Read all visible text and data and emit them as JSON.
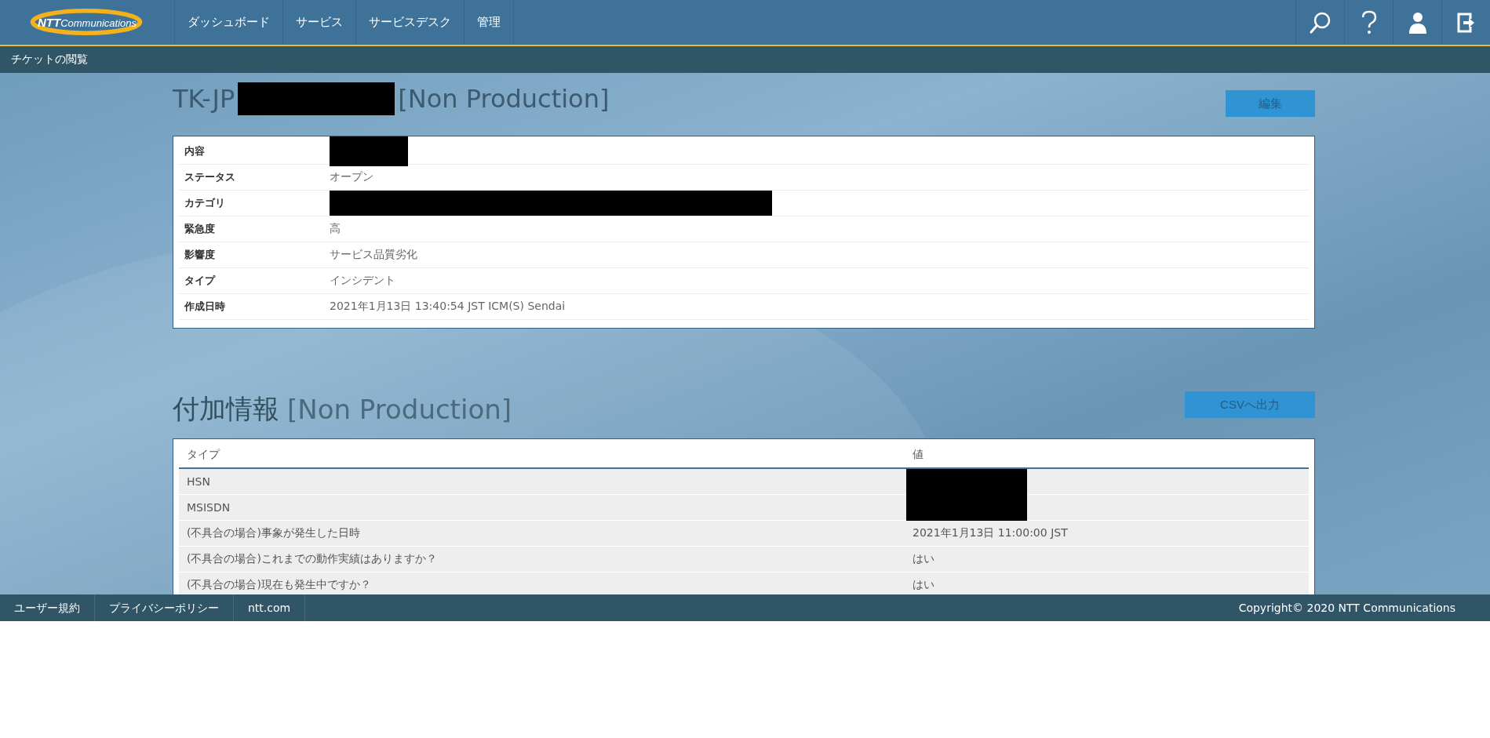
{
  "header": {
    "logo": {
      "bold": "NTT",
      "rest": "Communications"
    },
    "nav": [
      {
        "label": "ダッシュボード"
      },
      {
        "label": "サービス"
      },
      {
        "label": "サービスデスク"
      },
      {
        "label": "管理"
      }
    ]
  },
  "breadcrumb": "チケットの閲覧",
  "ticket": {
    "title_prefix": "TK-JP",
    "title_redacted": true,
    "title_suffix": "[Non Production]",
    "edit_button": "編集",
    "fields": [
      {
        "label": "内容",
        "kind": "redacted-short"
      },
      {
        "label": "ステータス",
        "kind": "text",
        "value": "オープン"
      },
      {
        "label": "カテゴリ",
        "kind": "redacted-long"
      },
      {
        "label": "緊急度",
        "kind": "text",
        "value": "高"
      },
      {
        "label": "影響度",
        "kind": "text",
        "value": "サービス品質劣化"
      },
      {
        "label": "タイプ",
        "kind": "text",
        "value": "インシデント"
      },
      {
        "label": "作成日時",
        "kind": "text",
        "value": "2021年1月13日 13:40:54 JST ICM(S) Sendai"
      }
    ]
  },
  "additional": {
    "title": "付加情報",
    "title_suffix": "[Non Production]",
    "csv_button": "CSVへ出力",
    "columns": [
      "タイプ",
      "値"
    ],
    "rows": [
      {
        "type": "HSN",
        "kind": "redacted"
      },
      {
        "type": "MSISDN",
        "kind": "redacted"
      },
      {
        "type": "(不具合の場合)事象が発生した日時",
        "kind": "text",
        "value": "2021年1月13日 11:00:00 JST"
      },
      {
        "type": "(不具合の場合)これまでの動作実績はありますか？",
        "kind": "text",
        "value": "はい"
      },
      {
        "type": "(不具合の場合)現在も発生中ですか？",
        "kind": "text",
        "value": "はい"
      }
    ]
  },
  "footer": {
    "links": [
      "ユーザー規約",
      "プライバシーポリシー",
      "ntt.com"
    ],
    "copyright": "Copyright© 2020 NTT Communications"
  }
}
